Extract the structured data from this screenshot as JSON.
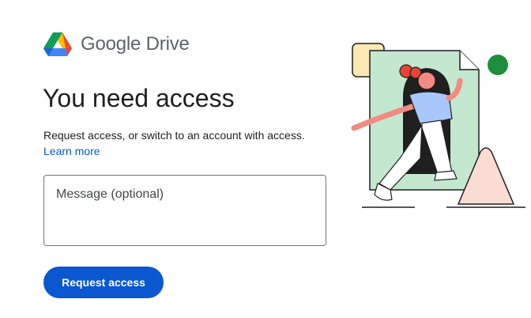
{
  "brand": {
    "name": "Google Drive",
    "logo_icon": "google-drive-logo-icon"
  },
  "title": "You need access",
  "description": "Request access, or switch to an account with access.",
  "learn_more": "Learn more",
  "message": {
    "placeholder": "Message (optional)",
    "value": ""
  },
  "request_button": "Request access",
  "colors": {
    "primary": "#0b57d0",
    "drive_green": "#0f9d58",
    "drive_yellow": "#fbbc04",
    "drive_blue": "#4285f4",
    "illustration_green": "#c4e7cf",
    "illustration_peach": "#fadcd5"
  }
}
